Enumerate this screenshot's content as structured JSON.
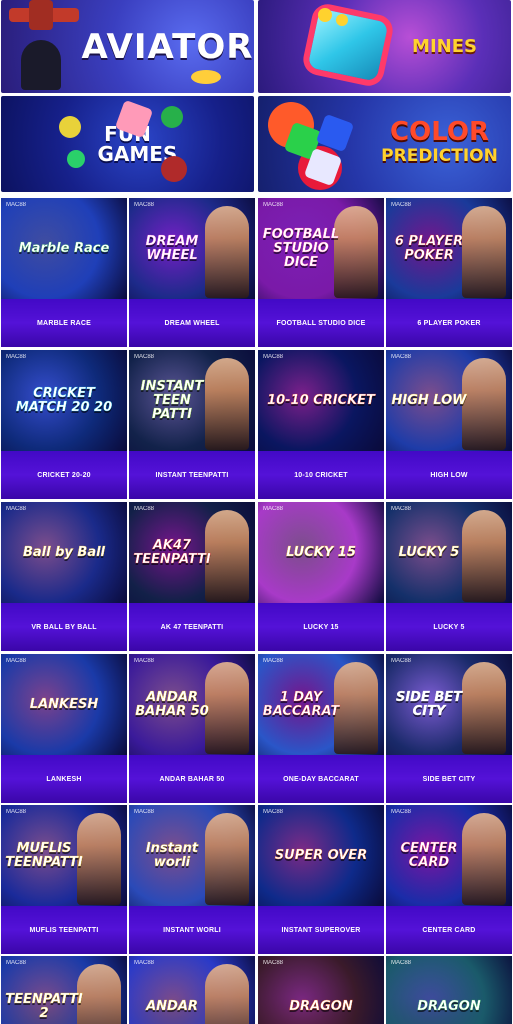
{
  "banners": {
    "aviator": "AVIATOR",
    "mines": "MINES",
    "fun_games": "FUN GAMES",
    "color_prediction": {
      "line1": "COLOR",
      "line2": "PREDICTION"
    }
  },
  "games": [
    {
      "label": "MARBLE RACE",
      "art": "Marble Race",
      "bg": "#1f3fb8",
      "accent": "#4ad06a",
      "figure": false
    },
    {
      "label": "DREAM WHEEL",
      "art": "DREAM WHEEL",
      "bg": "#1d2a8a",
      "accent": "#e84ad6",
      "figure": true
    },
    {
      "label": "FOOTBALL STUDIO DICE",
      "art": "FOOTBALL STUDIO DICE",
      "bg": "#7a1aa8",
      "accent": "#ff4aa8",
      "figure": true
    },
    {
      "label": "6 PLAYER POKER",
      "art": "6 PLAYER POKER",
      "bg": "#1a3a9a",
      "accent": "#e82a2a",
      "figure": true
    },
    {
      "label": "CRICKET 20-20",
      "art": "CRICKET MATCH 20 20",
      "bg": "#0e2a7a",
      "accent": "#2ad0f0",
      "figure": false
    },
    {
      "label": "INSTANT TEENPATTI",
      "art": "INSTANT TEEN PATTI",
      "bg": "#12224a",
      "accent": "#9ee84a",
      "figure": true
    },
    {
      "label": "10-10 CRICKET",
      "art": "10-10 CRICKET",
      "bg": "#0a1660",
      "accent": "#ff4a2a",
      "figure": false
    },
    {
      "label": "HIGH LOW",
      "art": "HIGH LOW",
      "bg": "#1e3ca8",
      "accent": "#ffd22e",
      "figure": true
    },
    {
      "label": "VR BALL BY BALL",
      "art": "Ball by Ball",
      "bg": "#1a2a8a",
      "accent": "#ffd22e",
      "figure": false
    },
    {
      "label": "AK 47 TEENPATTI",
      "art": "AK47 TEENPATTI",
      "bg": "#122048",
      "accent": "#e82a2a",
      "figure": true
    },
    {
      "label": "LUCKY 15",
      "art": "LUCKY 15",
      "bg": "#a83ac8",
      "accent": "#ffd22e",
      "figure": false
    },
    {
      "label": "LUCKY 5",
      "art": "LUCKY 5",
      "bg": "#14306a",
      "accent": "#ffd22e",
      "figure": true
    },
    {
      "label": "LANKESH",
      "art": "LANKESH",
      "bg": "#1a3aa8",
      "accent": "#ffb02e",
      "figure": false
    },
    {
      "label": "ANDAR BAHAR 50",
      "art": "ANDAR BAHAR 50",
      "bg": "#3a1a9a",
      "accent": "#ffd22e",
      "figure": true
    },
    {
      "label": "ONE-DAY BACCARAT",
      "art": "1 DAY BACCARAT",
      "bg": "#2a56c8",
      "accent": "#e82a2a",
      "figure": true
    },
    {
      "label": "SIDE BET CITY",
      "art": "SIDE BET CITY",
      "bg": "#1a2a6a",
      "accent": "#ffffff",
      "figure": true
    },
    {
      "label": "MUFLIS TEENPATTI",
      "art": "MUFLIS TEENPATTI",
      "bg": "#1a2a9a",
      "accent": "#ffd22e",
      "figure": true
    },
    {
      "label": "INSTANT WORLI",
      "art": "Instant worli",
      "bg": "#2a4ab8",
      "accent": "#ffd22e",
      "figure": true
    },
    {
      "label": "INSTANT SUPEROVER",
      "art": "SUPER OVER",
      "bg": "#0e2a8a",
      "accent": "#ff6a1a",
      "figure": false
    },
    {
      "label": "CENTER CARD",
      "art": "CENTER CARD",
      "bg": "#1a2ca8",
      "accent": "#ff2a6a",
      "figure": true
    },
    {
      "label": "",
      "art": "TEENPATTI 2",
      "bg": "#1a3aa8",
      "accent": "#ffd22e",
      "figure": true
    },
    {
      "label": "",
      "art": "ANDAR",
      "bg": "#2a3ac8",
      "accent": "#ffd22e",
      "figure": true
    },
    {
      "label": "",
      "art": "DRAGON",
      "bg": "#3a1a2a",
      "accent": "#ff6a1a",
      "figure": false
    },
    {
      "label": "",
      "art": "DRAGON",
      "bg": "#1a5a6a",
      "accent": "#4ad06a",
      "figure": false
    }
  ],
  "brand_mark": "MAC88"
}
